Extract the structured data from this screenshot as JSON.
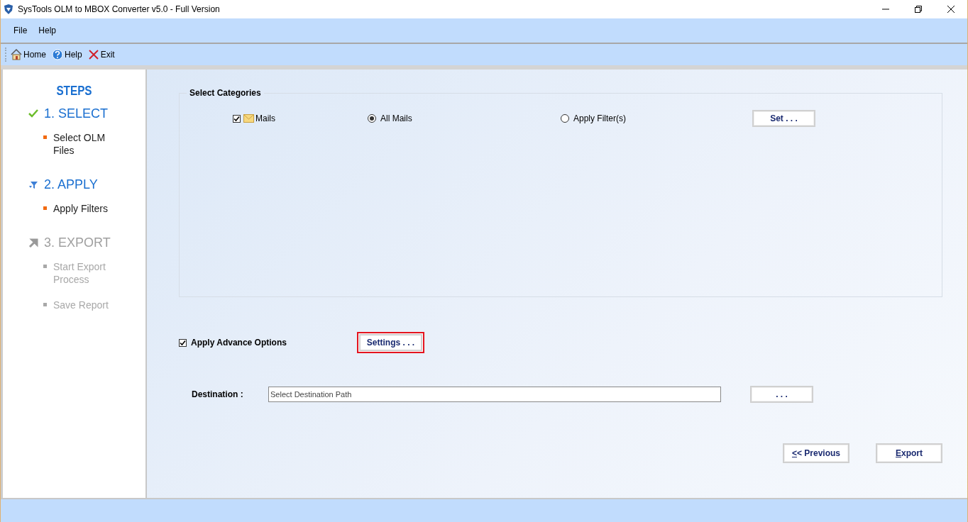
{
  "window": {
    "title": "SysTools OLM to MBOX Converter v5.0 - Full Version"
  },
  "menu": [
    "File",
    "Help"
  ],
  "toolbar": [
    {
      "kind": "home",
      "label": "Home"
    },
    {
      "kind": "help",
      "label": "Help"
    },
    {
      "kind": "exit",
      "label": "Exit"
    }
  ],
  "steps": {
    "title": "STEPS",
    "items": [
      {
        "kind": "check",
        "label": "1. SELECT",
        "enabled": true,
        "substeps": [
          "Select OLM Files"
        ]
      },
      {
        "kind": "filter",
        "label": "2. APPLY",
        "enabled": true,
        "substeps": [
          "Apply Filters"
        ]
      },
      {
        "kind": "arrow",
        "label": "3. EXPORT",
        "enabled": false,
        "substeps": [
          "Start Export Process",
          "Save Report"
        ]
      }
    ]
  },
  "categories": {
    "title": "Select Categories",
    "mails": {
      "label": "Mails",
      "checked": true
    },
    "options": [
      {
        "label": "All Mails",
        "selected": true
      },
      {
        "label": "Apply Filter(s)",
        "selected": false
      }
    ],
    "set_button": "Set . . ."
  },
  "advance": {
    "label": "Apply Advance Options",
    "checked": true,
    "button": "Settings . . .",
    "highlighted": true
  },
  "destination": {
    "label": "Destination :",
    "placeholder": "Select Destination Path",
    "browse": ". . ."
  },
  "buttons": [
    {
      "label": "<< Previous"
    },
    {
      "label": "Export"
    }
  ]
}
